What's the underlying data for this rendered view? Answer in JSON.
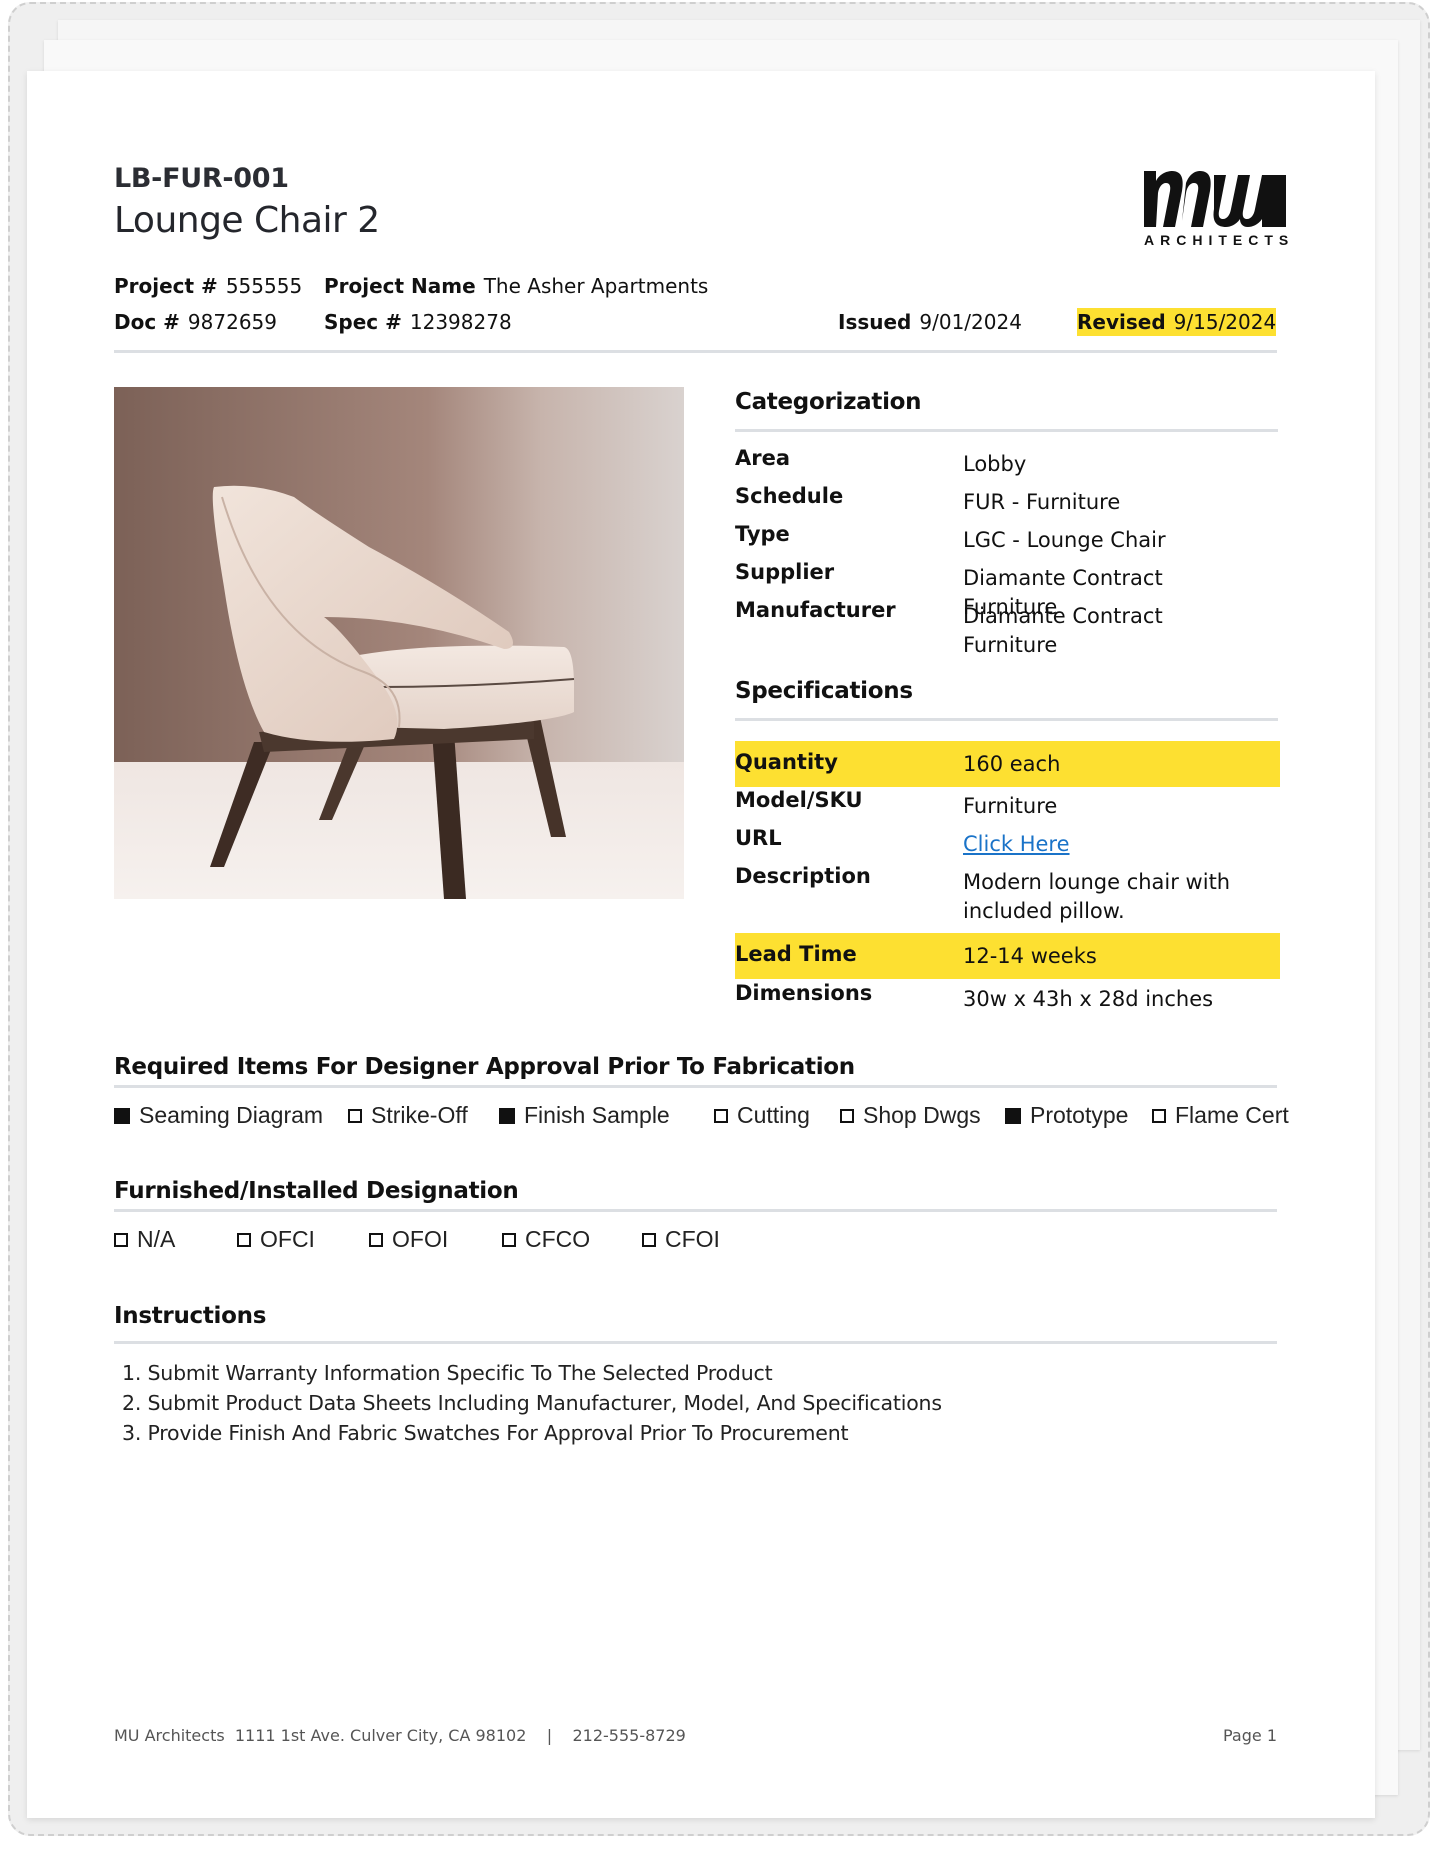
{
  "document": {
    "code": "LB-FUR-001",
    "title": "Lounge Chair 2"
  },
  "brand": {
    "logo_mark": "mu",
    "logo_subtitle": "ARCHITECTS",
    "accent_color": "#fde031",
    "link_color": "#1a73c8"
  },
  "meta": {
    "project_number_label": "Project #",
    "project_number": "555555",
    "project_name_label": "Project Name",
    "project_name": "The Asher Apartments",
    "doc_number_label": "Doc #",
    "doc_number": "9872659",
    "spec_number_label": "Spec #",
    "spec_number": "12398278",
    "issued_label": "Issued",
    "issued": "9/01/2024",
    "revised_label": "Revised",
    "revised": "9/15/2024"
  },
  "image": {
    "subject": "Modern lounge chair with cream upholstery and dark wood legs"
  },
  "categorization": {
    "heading": "Categorization",
    "rows": [
      {
        "label": "Area",
        "value": "Lobby"
      },
      {
        "label": "Schedule",
        "value": "FUR - Furniture"
      },
      {
        "label": "Type",
        "value": "LGC - Lounge Chair"
      },
      {
        "label": "Supplier",
        "value": "Diamante Contract Furniture"
      },
      {
        "label": "Manufacturer",
        "value": "Diamante Contract Furniture"
      }
    ]
  },
  "specifications": {
    "heading": "Specifications",
    "rows": [
      {
        "label": "Quantity",
        "value": "160 each",
        "highlight": true
      },
      {
        "label": "Model/SKU",
        "value": "Furniture"
      },
      {
        "label": "URL",
        "value": "Click Here",
        "link": true
      },
      {
        "label": "Description",
        "value": "Modern lounge chair with included pillow."
      },
      {
        "label": "Lead Time",
        "value": "12-14 weeks",
        "highlight": true
      },
      {
        "label": "Dimensions",
        "value": "30w x 43h x 28d inches"
      }
    ]
  },
  "required_items": {
    "heading": "Required Items For Designer Approval Prior To Fabrication",
    "items": [
      {
        "label": "Seaming Diagram",
        "checked": true
      },
      {
        "label": "Strike-Off",
        "checked": false
      },
      {
        "label": "Finish Sample",
        "checked": true
      },
      {
        "label": "Cutting",
        "checked": false
      },
      {
        "label": "Shop Dwgs",
        "checked": false
      },
      {
        "label": "Prototype",
        "checked": true
      },
      {
        "label": "Flame Cert",
        "checked": false
      }
    ]
  },
  "designation": {
    "heading": "Furnished/Installed Designation",
    "items": [
      {
        "label": "N/A",
        "checked": false
      },
      {
        "label": "OFCI",
        "checked": false
      },
      {
        "label": "OFOI",
        "checked": false
      },
      {
        "label": "CFCO",
        "checked": false
      },
      {
        "label": "CFOI",
        "checked": false
      }
    ]
  },
  "instructions": {
    "heading": "Instructions",
    "items": [
      "1. Submit Warranty Information Specific To The Selected Product",
      "2. Submit Product Data Sheets Including Manufacturer, Model, And Specifications",
      "3. Provide Finish And Fabric Swatches For Approval Prior To Procurement"
    ]
  },
  "footer": {
    "company": "MU Architects",
    "address": "1111 1st Ave. Culver City, CA 98102",
    "separator": "|",
    "phone": "212-555-8729",
    "page": "Page 1"
  }
}
